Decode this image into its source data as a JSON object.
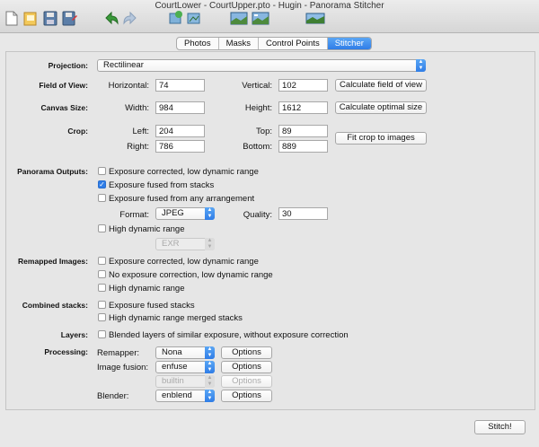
{
  "window": {
    "title": "CourtLower - CourtUpper.pto - Hugin - Panorama Stitcher"
  },
  "toolbar": {
    "icons": [
      "new-project-icon",
      "open-project-icon",
      "save-icon",
      "save-as-icon",
      "undo-icon",
      "redo-icon",
      "add-images-icon",
      "control-points-icon",
      "preview-icon",
      "fast-preview-icon",
      "stitch-icon"
    ]
  },
  "tabs": [
    "Photos",
    "Masks",
    "Control Points",
    "Stitcher"
  ],
  "projection": {
    "label": "Projection:",
    "value": "Rectilinear"
  },
  "fov": {
    "label": "Field of View:",
    "h_label": "Horizontal:",
    "h_value": "74",
    "v_label": "Vertical:",
    "v_value": "102",
    "button": "Calculate field of view"
  },
  "canvas": {
    "label": "Canvas Size:",
    "w_label": "Width:",
    "w_value": "984",
    "h_label": "Height:",
    "h_value": "1612",
    "button": "Calculate optimal size"
  },
  "crop": {
    "label": "Crop:",
    "left_label": "Left:",
    "left": "204",
    "top_label": "Top:",
    "top": "89",
    "right_label": "Right:",
    "right": "786",
    "bottom_label": "Bottom:",
    "bottom": "889",
    "button": "Fit crop to images"
  },
  "outputs": {
    "label": "Panorama Outputs:",
    "opt1": "Exposure corrected, low dynamic range",
    "opt2": "Exposure fused from stacks",
    "opt3": "Exposure fused from any arrangement",
    "format_label": "Format:",
    "format": "JPEG",
    "quality_label": "Quality:",
    "quality": "30",
    "hdr": "High dynamic range",
    "hdr_format": "EXR"
  },
  "remapped": {
    "label": "Remapped Images:",
    "opt1": "Exposure corrected, low dynamic range",
    "opt2": "No exposure correction, low dynamic range",
    "opt3": "High dynamic range"
  },
  "combined": {
    "label": "Combined stacks:",
    "opt1": "Exposure fused stacks",
    "opt2": "High dynamic range merged stacks"
  },
  "layers": {
    "label": "Layers:",
    "opt1": "Blended layers of similar exposure, without exposure correction"
  },
  "processing": {
    "label": "Processing:",
    "remapper_label": "Remapper:",
    "remapper": "Nona",
    "fusion_label": "Image fusion:",
    "fusion": "enfuse",
    "hdr_merge": "builtin",
    "blender_label": "Blender:",
    "blender": "enblend",
    "options": "Options"
  },
  "stitch_button": "Stitch!"
}
